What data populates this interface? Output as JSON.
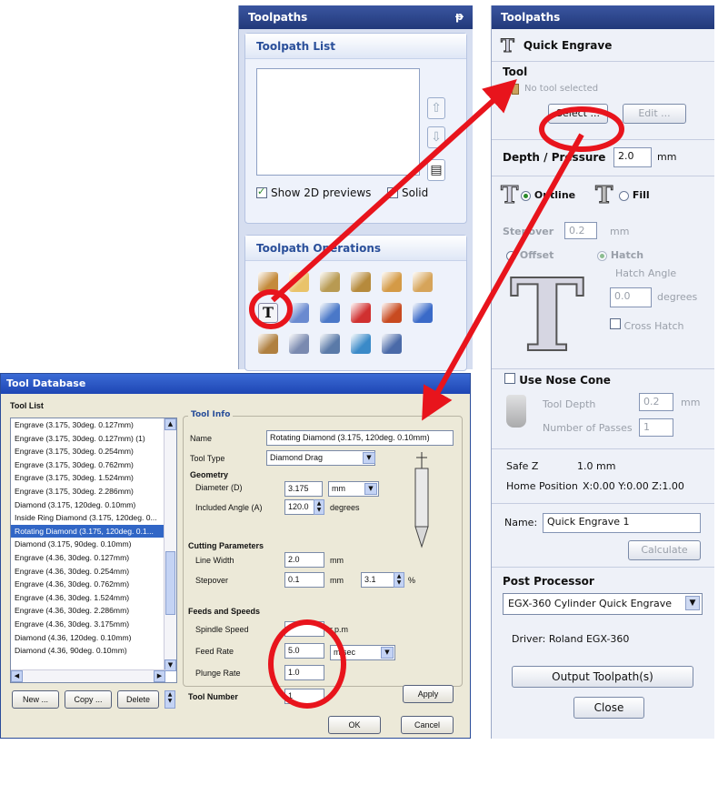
{
  "left_panel": {
    "title": "Toolpaths",
    "pin": "ᵽ",
    "list_section": {
      "title": "Toolpath List",
      "show_previews_label": "Show 2D previews",
      "show_previews_checked": true,
      "solid_label": "Solid",
      "solid_checked": false
    },
    "operations_section": {
      "title": "Toolpath Operations",
      "icons": [
        "profile-icon",
        "pocket-icon",
        "drill-icon",
        "vcarve-icon",
        "texture-icon",
        "fluting-icon",
        "quick-engrave-icon",
        "edit-icon",
        "array-icon",
        "delete-icon",
        "recalculate-icon",
        "save-icon",
        "material-icon",
        "preview-icon",
        "zero-icon",
        "template-icon",
        "merge-icon"
      ]
    }
  },
  "right_panel": {
    "title": "Toolpaths",
    "header": "Quick Engrave",
    "tool": {
      "heading": "Tool",
      "status": "No tool selected",
      "select_label": "Select ...",
      "edit_label": "Edit ..."
    },
    "depth": {
      "label": "Depth / Pressure",
      "value": "2.0",
      "unit": "mm"
    },
    "fill_mode": {
      "outline_label": "Outline",
      "fill_label": "Fill",
      "selected": "outline"
    },
    "stepover": {
      "label": "Stepover",
      "value": "0.2",
      "unit": "mm"
    },
    "offset_label": "Offset",
    "hatch": {
      "label": "Hatch",
      "angle_label": "Hatch Angle",
      "angle_value": "0.0",
      "angle_unit": "degrees",
      "cross_label": "Cross Hatch"
    },
    "nose_cone": {
      "label": "Use Nose Cone",
      "tool_depth_label": "Tool Depth",
      "tool_depth_value": "0.2",
      "tool_depth_unit": "mm",
      "passes_label": "Number of Passes",
      "passes_value": "1"
    },
    "safe_z": {
      "label": "Safe Z",
      "value": "1.0 mm"
    },
    "home": {
      "label": "Home Position",
      "value": "X:0.00 Y:0.00 Z:1.00"
    },
    "name": {
      "label": "Name:",
      "value": "Quick Engrave 1"
    },
    "calculate_label": "Calculate",
    "post": {
      "heading": "Post Processor",
      "selected": "EGX-360 Cylinder Quick Engrave",
      "driver": "Driver: Roland EGX-360"
    },
    "output_label": "Output Toolpath(s)",
    "close_label": "Close"
  },
  "tool_db": {
    "title": "Tool Database",
    "list_heading": "Tool List",
    "tools": [
      "Engrave (3.175, 30deg. 0.127mm)",
      "Engrave (3.175, 30deg. 0.127mm) (1)",
      "Engrave (3.175, 30deg. 0.254mm)",
      "Engrave (3.175, 30deg. 0.762mm)",
      "Engrave (3.175, 30deg. 1.524mm)",
      "Engrave (3.175, 30deg. 2.286mm)",
      "Diamond (3.175, 120deg. 0.10mm)",
      "Inside Ring Diamond (3.175, 120deg. 0...",
      "Rotating Diamond (3.175, 120deg. 0.1...",
      "Diamond (3.175, 90deg. 0.10mm)",
      "Engrave (4.36, 30deg. 0.127mm)",
      "Engrave (4.36, 30deg. 0.254mm)",
      "Engrave (4.36, 30deg. 0.762mm)",
      "Engrave (4.36, 30deg. 1.524mm)",
      "Engrave (4.36, 30deg. 2.286mm)",
      "Engrave (4.36, 30deg. 3.175mm)",
      "Diamond (4.36, 120deg. 0.10mm)",
      "Diamond (4.36, 90deg. 0.10mm)"
    ],
    "selected_index": 8,
    "new_label": "New ...",
    "copy_label": "Copy ...",
    "delete_label": "Delete",
    "info": {
      "heading": "Tool Info",
      "name_label": "Name",
      "name_value": "Rotating Diamond (3.175, 120deg. 0.10mm)",
      "type_label": "Tool Type",
      "type_value": "Diamond Drag",
      "geometry_heading": "Geometry",
      "diameter_label": "Diameter (D)",
      "diameter_value": "3.175",
      "diameter_unit": "mm",
      "angle_label": "Included Angle (A)",
      "angle_value": "120.0",
      "angle_unit": "degrees",
      "cutting_heading": "Cutting Parameters",
      "line_width_label": "Line Width",
      "line_width_value": "2.0",
      "line_width_unit": "mm",
      "stepover_label": "Stepover",
      "stepover_value": "0.1",
      "stepover_unit": "mm",
      "stepover_pct": "3.1",
      "pct_sign": "%",
      "feeds_heading": "Feeds and Speeds",
      "spindle_label": "Spindle Speed",
      "spindle_unit": "r.p.m",
      "feed_label": "Feed Rate",
      "feed_value": "5.0",
      "plunge_label": "Plunge Rate",
      "plunge_value": "1.0",
      "rate_unit": "m/sec",
      "tool_number_label": "Tool Number",
      "tool_number_value": "1"
    },
    "apply_label": "Apply",
    "ok_label": "OK",
    "cancel_label": "Cancel"
  },
  "colors": {
    "annotation_red": "#e8141c",
    "title_blue": "#22397a",
    "selection_blue": "#3166c6"
  }
}
